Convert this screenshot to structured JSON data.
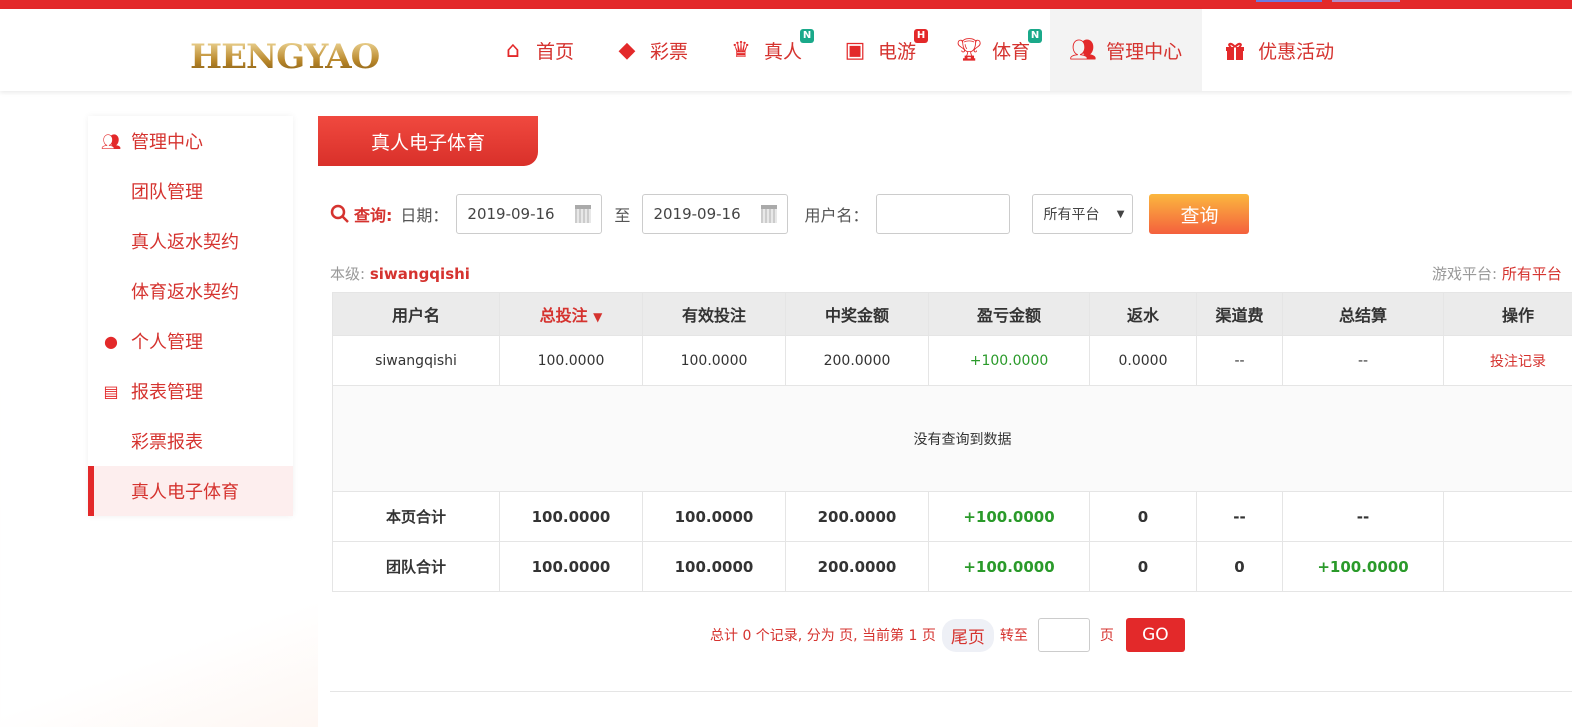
{
  "header": {
    "logo_text": "HENGYAO恒耀",
    "nav": [
      {
        "label": "首页",
        "icon": "home-icon"
      },
      {
        "label": "彩票",
        "icon": "lottery-ticket-icon"
      },
      {
        "label": "真人",
        "icon": "live-dealer-icon",
        "badge": "N"
      },
      {
        "label": "电游",
        "icon": "slot-machine-icon",
        "badge": "H"
      },
      {
        "label": "体育",
        "icon": "trophy-icon",
        "badge": "N"
      },
      {
        "label": "管理中心",
        "icon": "users-icon"
      },
      {
        "label": "优惠活动",
        "icon": "gift-icon"
      }
    ]
  },
  "sidebar": {
    "items": [
      "管理中心",
      "团队管理",
      "真人返水契约",
      "体育返水契约",
      "个人管理",
      "报表管理",
      "彩票报表",
      "真人电子体育"
    ]
  },
  "main": {
    "tab": "真人电子体育",
    "search": {
      "label": "查询:",
      "date_label": "日期：",
      "start": "2019-09-16",
      "to": "至",
      "end": "2019-09-16",
      "user_label": "用户名：",
      "user_value": "",
      "platform": "所有平台",
      "submit": "查询"
    },
    "level_label": "本级:",
    "level_user": "siwangqishi",
    "platform_label": "游戏平台:",
    "platform_value": "所有平台",
    "table": {
      "headers": [
        "用户名",
        "总投注",
        "有效投注",
        "中奖金额",
        "盈亏金额",
        "返水",
        "渠道费",
        "总结算",
        "操作"
      ],
      "rows": [
        [
          "siwangqishi",
          "100.0000",
          "100.0000",
          "200.0000",
          "+100.0000",
          "0.0000",
          "--",
          "--",
          "投注记录"
        ]
      ],
      "empty": "没有查询到数据",
      "page_total": [
        "本页合计",
        "100.0000",
        "100.0000",
        "200.0000",
        "+100.0000",
        "0",
        "--",
        "--",
        ""
      ],
      "team_total": [
        "团队合计",
        "100.0000",
        "100.0000",
        "200.0000",
        "+100.0000",
        "0",
        "0",
        "+100.0000",
        ""
      ]
    },
    "pager": {
      "summary": "总计 0 个记录, 分为 页, 当前第 1 页",
      "last": "尾页",
      "goto": "转至",
      "page_unit": "页",
      "go": "GO"
    }
  }
}
